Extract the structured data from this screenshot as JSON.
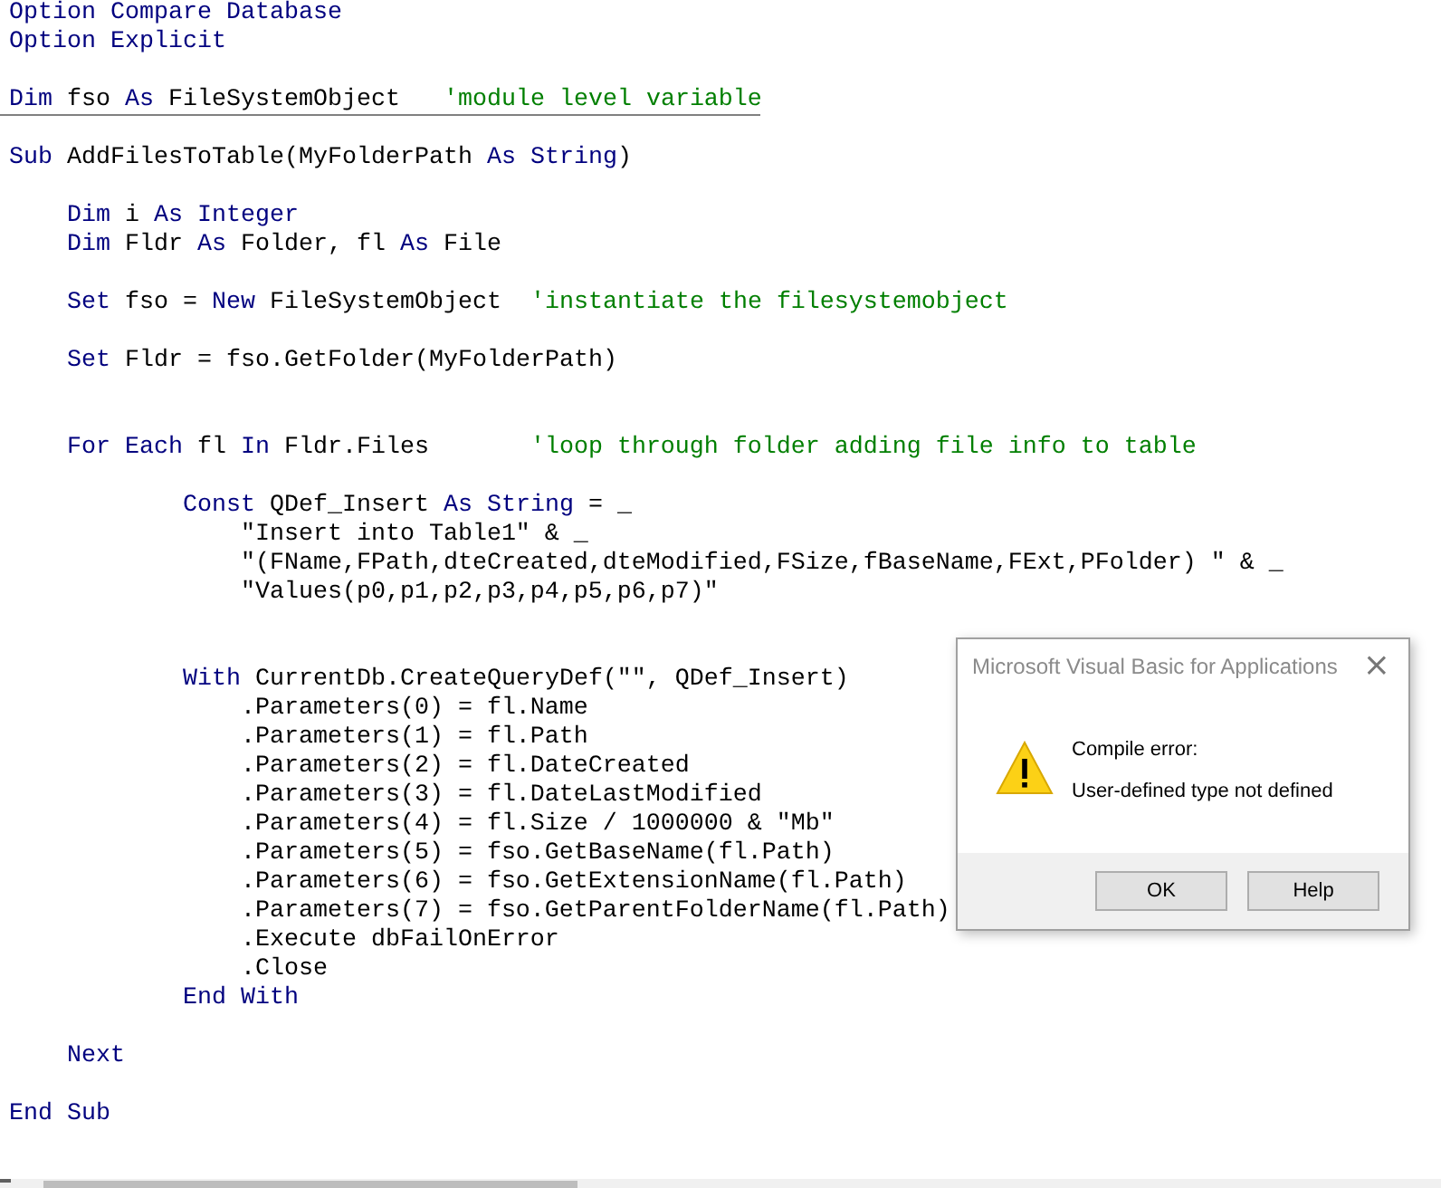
{
  "code_lines": [
    {
      "kind": "code",
      "tokens": [
        {
          "kind": "keyword",
          "text": "Option Compare Database"
        }
      ]
    },
    {
      "kind": "code",
      "tokens": [
        {
          "kind": "keyword",
          "text": "Option Explicit"
        }
      ]
    },
    {
      "kind": "blank"
    },
    {
      "kind": "code",
      "tokens": [
        {
          "kind": "keyword",
          "text": "Dim"
        },
        {
          "kind": "text",
          "text": " fso "
        },
        {
          "kind": "keyword",
          "text": "As"
        },
        {
          "kind": "text",
          "text": " FileSystemObject   "
        },
        {
          "kind": "comment",
          "text": "'module level variable"
        }
      ]
    },
    {
      "kind": "separator"
    },
    {
      "kind": "blank"
    },
    {
      "kind": "code",
      "tokens": [
        {
          "kind": "keyword",
          "text": "Sub"
        },
        {
          "kind": "text",
          "text": " AddFilesToTable(MyFolderPath "
        },
        {
          "kind": "keyword",
          "text": "As String"
        },
        {
          "kind": "text",
          "text": ")"
        }
      ]
    },
    {
      "kind": "blank"
    },
    {
      "kind": "code",
      "tokens": [
        {
          "kind": "keyword",
          "text": "    Dim"
        },
        {
          "kind": "text",
          "text": " i "
        },
        {
          "kind": "keyword",
          "text": "As Integer"
        }
      ]
    },
    {
      "kind": "code",
      "tokens": [
        {
          "kind": "keyword",
          "text": "    Dim"
        },
        {
          "kind": "text",
          "text": " Fldr "
        },
        {
          "kind": "keyword",
          "text": "As"
        },
        {
          "kind": "text",
          "text": " Folder, fl "
        },
        {
          "kind": "keyword",
          "text": "As"
        },
        {
          "kind": "text",
          "text": " File"
        }
      ]
    },
    {
      "kind": "blank"
    },
    {
      "kind": "code",
      "tokens": [
        {
          "kind": "keyword",
          "text": "    Set"
        },
        {
          "kind": "text",
          "text": " fso = "
        },
        {
          "kind": "keyword",
          "text": "New"
        },
        {
          "kind": "text",
          "text": " FileSystemObject  "
        },
        {
          "kind": "comment",
          "text": "'instantiate the filesystemobject"
        }
      ]
    },
    {
      "kind": "blank"
    },
    {
      "kind": "code",
      "tokens": [
        {
          "kind": "keyword",
          "text": "    Set"
        },
        {
          "kind": "text",
          "text": " Fldr = fso.GetFolder(MyFolderPath)"
        }
      ]
    },
    {
      "kind": "blank"
    },
    {
      "kind": "blank"
    },
    {
      "kind": "code",
      "tokens": [
        {
          "kind": "keyword",
          "text": "    For Each"
        },
        {
          "kind": "text",
          "text": " fl "
        },
        {
          "kind": "keyword",
          "text": "In"
        },
        {
          "kind": "text",
          "text": " Fldr.Files       "
        },
        {
          "kind": "comment",
          "text": "'loop through folder adding file info to table"
        }
      ]
    },
    {
      "kind": "blank"
    },
    {
      "kind": "code",
      "tokens": [
        {
          "kind": "keyword",
          "text": "            Const"
        },
        {
          "kind": "text",
          "text": " QDef_Insert "
        },
        {
          "kind": "keyword",
          "text": "As String"
        },
        {
          "kind": "text",
          "text": " = _"
        }
      ]
    },
    {
      "kind": "code",
      "tokens": [
        {
          "kind": "text",
          "text": "                \"Insert into Table1\" & _"
        }
      ]
    },
    {
      "kind": "code",
      "tokens": [
        {
          "kind": "text",
          "text": "                \"(FName,FPath,dteCreated,dteModified,FSize,fBaseName,FExt,PFolder) \" & _"
        }
      ]
    },
    {
      "kind": "code",
      "tokens": [
        {
          "kind": "text",
          "text": "                \"Values(p0,p1,p2,p3,p4,p5,p6,p7)\""
        }
      ]
    },
    {
      "kind": "blank"
    },
    {
      "kind": "blank"
    },
    {
      "kind": "code",
      "tokens": [
        {
          "kind": "keyword",
          "text": "            With"
        },
        {
          "kind": "text",
          "text": " CurrentDb.CreateQueryDef(\"\", QDef_Insert)"
        }
      ]
    },
    {
      "kind": "code",
      "tokens": [
        {
          "kind": "text",
          "text": "                .Parameters(0) = fl.Name"
        }
      ]
    },
    {
      "kind": "code",
      "tokens": [
        {
          "kind": "text",
          "text": "                .Parameters(1) = fl.Path"
        }
      ]
    },
    {
      "kind": "code",
      "tokens": [
        {
          "kind": "text",
          "text": "                .Parameters(2) = fl.DateCreated"
        }
      ]
    },
    {
      "kind": "code",
      "tokens": [
        {
          "kind": "text",
          "text": "                .Parameters(3) = fl.DateLastModified"
        }
      ]
    },
    {
      "kind": "code",
      "tokens": [
        {
          "kind": "text",
          "text": "                .Parameters(4) = fl.Size / 1000000 & \"Mb\""
        }
      ]
    },
    {
      "kind": "code",
      "tokens": [
        {
          "kind": "text",
          "text": "                .Parameters(5) = fso.GetBaseName(fl.Path)"
        }
      ]
    },
    {
      "kind": "code",
      "tokens": [
        {
          "kind": "text",
          "text": "                .Parameters(6) = fso.GetExtensionName(fl.Path)"
        }
      ]
    },
    {
      "kind": "code",
      "tokens": [
        {
          "kind": "text",
          "text": "                .Parameters(7) = fso.GetParentFolderName(fl.Path)"
        }
      ]
    },
    {
      "kind": "code",
      "tokens": [
        {
          "kind": "text",
          "text": "                .Execute dbFailOnError"
        }
      ]
    },
    {
      "kind": "code",
      "tokens": [
        {
          "kind": "text",
          "text": "                .Close"
        }
      ]
    },
    {
      "kind": "code",
      "tokens": [
        {
          "kind": "keyword",
          "text": "            End With"
        }
      ]
    },
    {
      "kind": "blank"
    },
    {
      "kind": "code",
      "tokens": [
        {
          "kind": "keyword",
          "text": "    Next"
        }
      ]
    },
    {
      "kind": "blank"
    },
    {
      "kind": "code",
      "tokens": [
        {
          "kind": "keyword",
          "text": "End Sub"
        }
      ]
    }
  ],
  "dialog": {
    "title": "Microsoft Visual Basic for Applications",
    "close": "×",
    "heading": "Compile error:",
    "message": "User-defined type not defined",
    "buttons": [
      "OK",
      "Help"
    ]
  }
}
